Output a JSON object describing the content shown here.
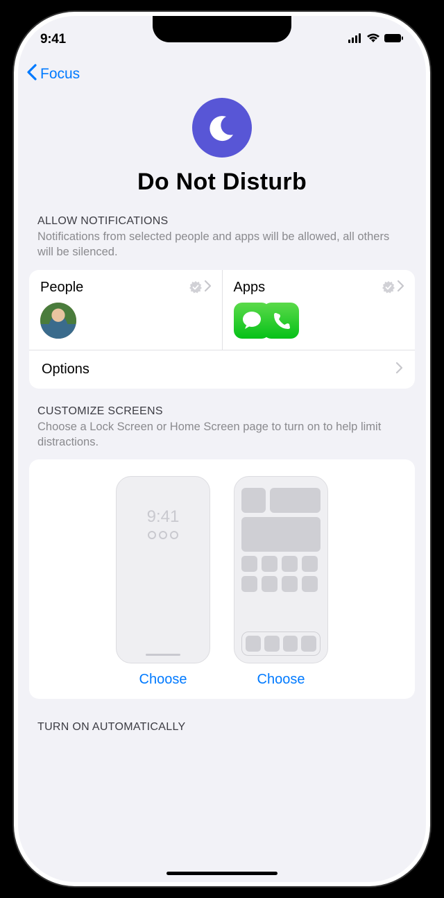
{
  "status": {
    "time": "9:41"
  },
  "nav": {
    "back_label": "Focus"
  },
  "hero": {
    "title": "Do Not Disturb"
  },
  "sections": {
    "allow": {
      "label": "ALLOW NOTIFICATIONS",
      "desc": "Notifications from selected people and apps will be allowed, all others will be silenced.",
      "people_label": "People",
      "apps_label": "Apps",
      "options_label": "Options"
    },
    "screens": {
      "label": "CUSTOMIZE SCREENS",
      "desc": "Choose a Lock Screen or Home Screen page to turn on to help limit distractions.",
      "mini_time": "9:41",
      "choose_label": "Choose"
    },
    "auto": {
      "label": "TURN ON AUTOMATICALLY"
    }
  }
}
